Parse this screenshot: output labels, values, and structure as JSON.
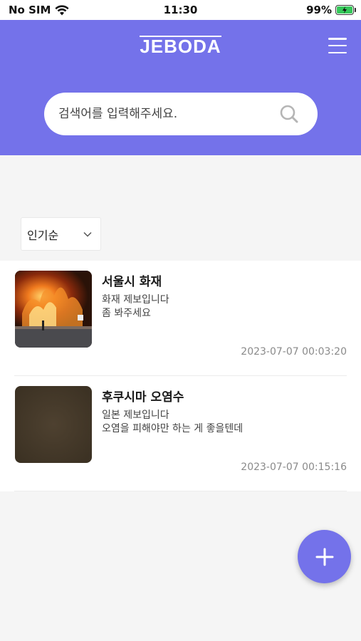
{
  "status_bar": {
    "carrier": "No SIM",
    "time": "11:30",
    "battery": "99%"
  },
  "header": {
    "logo": "JEBODA"
  },
  "search": {
    "placeholder": "검색어를 입력해주세요."
  },
  "sort": {
    "selected": "인기순"
  },
  "posts": [
    {
      "title": "서울시 화재",
      "body_lines": [
        "화재 제보입니다",
        "좀 봐주세요"
      ],
      "date": "2023-07-07 00:03:20"
    },
    {
      "title": "후쿠시마 오염수",
      "body_lines": [
        "일본 제보입니다",
        "오염을 피해야만 하는 게 좋을텐데"
      ],
      "date": "2023-07-07 00:15:16"
    }
  ],
  "colors": {
    "brand": "#7472ea",
    "battery": "#35c759"
  },
  "icons": [
    "wifi-icon",
    "battery-icon",
    "menu-icon",
    "search-icon",
    "chevron-down-icon",
    "plus-icon"
  ]
}
